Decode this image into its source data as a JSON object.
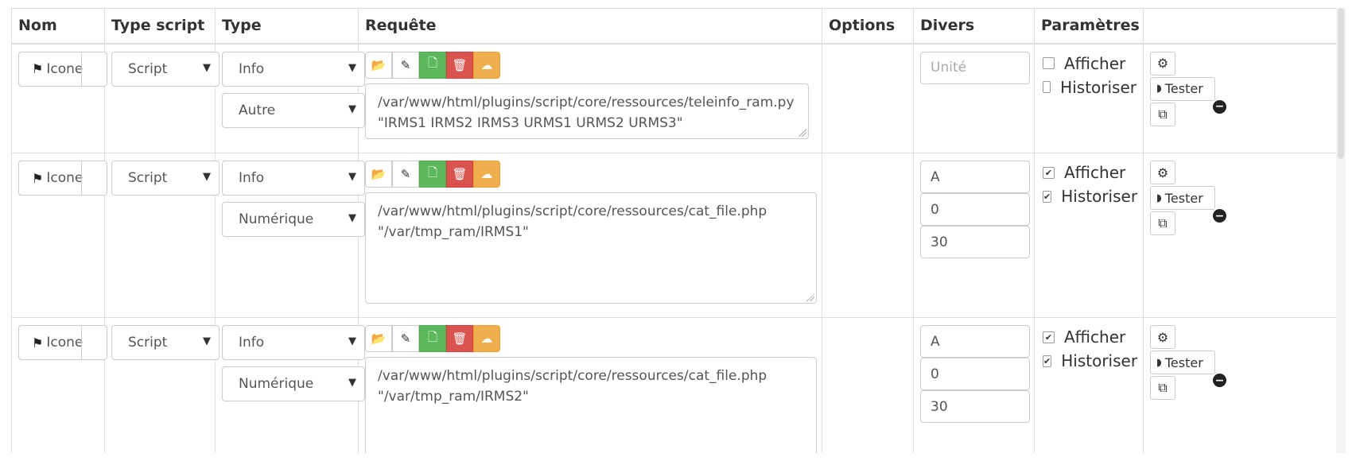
{
  "headers": {
    "nom": "Nom",
    "type_script": "Type script",
    "type": "Type",
    "requete": "Requête",
    "options": "Options",
    "divers": "Divers",
    "parametres": "Paramètres"
  },
  "common": {
    "name_placeholder": "Icone",
    "afficher": "Afficher",
    "historiser": "Historiser",
    "tester": "Tester"
  },
  "rows": [
    {
      "type_script": "Script",
      "type": "Info",
      "subtype": "Autre",
      "request_line1": "/var/www/html/plugins/script/core/ressources/teleinfo_ram.py",
      "request_line2": "\"IRMS1 IRMS2 IRMS3 URMS1 URMS2 URMS3\"",
      "unit_placeholder": "Unité",
      "afficher_checked": false,
      "historiser_checked": false
    },
    {
      "type_script": "Script",
      "type": "Info",
      "subtype": "Numérique",
      "request_line1": "/var/www/html/plugins/script/core/ressources/cat_file.php",
      "request_line2": "\"/var/tmp_ram/IRMS1\"",
      "unit": "A",
      "min": "0",
      "max": "30",
      "afficher_checked": true,
      "historiser_checked": true
    },
    {
      "type_script": "Script",
      "type": "Info",
      "subtype": "Numérique",
      "request_line1": "/var/www/html/plugins/script/core/ressources/cat_file.php",
      "request_line2": "\"/var/tmp_ram/IRMS2\"",
      "unit": "A",
      "min": "0",
      "max": "30",
      "afficher_checked": true,
      "historiser_checked": true
    }
  ]
}
